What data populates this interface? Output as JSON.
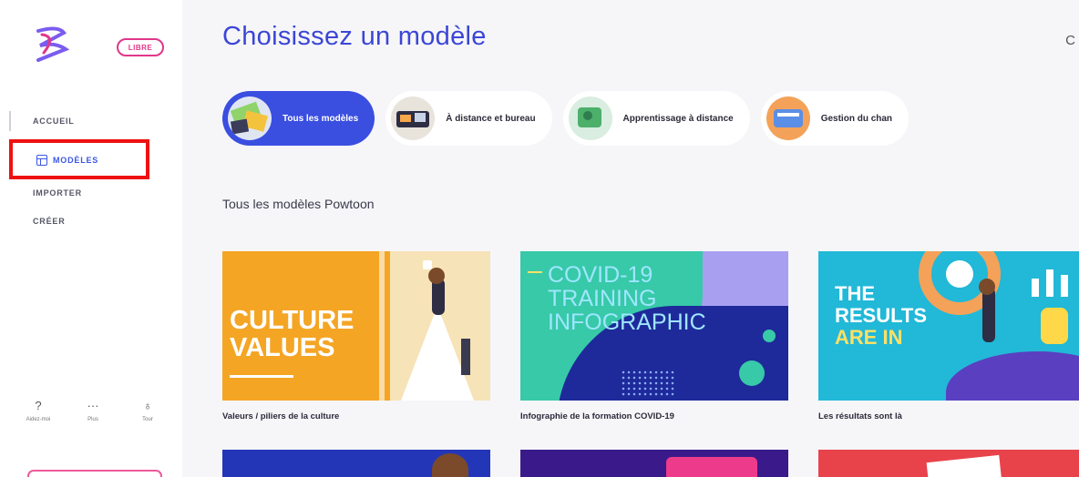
{
  "sidebar": {
    "badge": "LIBRE",
    "nav": [
      {
        "label": "ACCUEIL"
      },
      {
        "label": "MODÈLES"
      },
      {
        "label": "IMPORTER"
      },
      {
        "label": "CRÉER"
      }
    ],
    "tools": [
      {
        "symbol": "?",
        "label": "Aidez-moi",
        "icon": "help-icon"
      },
      {
        "symbol": "···",
        "label": "Plus",
        "icon": "more-icon"
      },
      {
        "symbol": "♁",
        "label": "Tour",
        "icon": "tour-icon"
      }
    ]
  },
  "main": {
    "title": "Choisissez un modèle",
    "corner_char": "C",
    "categories": [
      {
        "label": "Tous les modèles",
        "active": true
      },
      {
        "label": "À distance et bureau",
        "active": false
      },
      {
        "label": "Apprentissage à distance",
        "active": false
      },
      {
        "label": "Gestion du chan",
        "active": false
      }
    ],
    "section_title": "Tous les modèles Powtoon",
    "cards": [
      {
        "caption": "Valeurs / piliers de la culture",
        "line1": "CULTURE",
        "line2": "VALUES"
      },
      {
        "caption": "Infographie de la formation COVID-19",
        "line1": "COVID-19",
        "line2": "TRAINING",
        "line3": "INFOGRAPHIC"
      },
      {
        "caption": "Les résultats sont là",
        "line1": "THE",
        "line2": "RESULTS",
        "line3": "ARE IN"
      }
    ]
  },
  "colors": {
    "accent": "#3a4ee0",
    "title": "#3b46d6",
    "highlight": "#ee1111",
    "brand_pink": "#e0368a"
  }
}
